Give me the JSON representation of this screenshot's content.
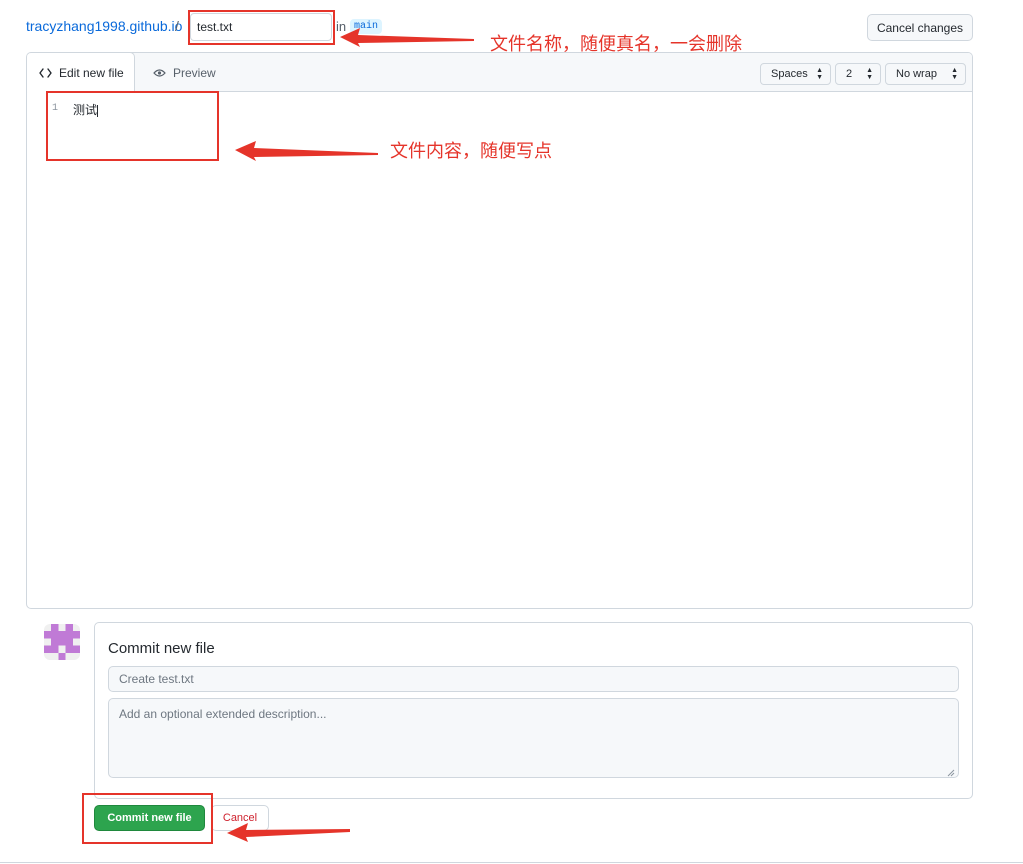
{
  "header": {
    "repo": "tracyzhang1998.github.io",
    "separator": "/",
    "filename_value": "test.txt",
    "in_label": "in",
    "branch": "main",
    "cancel_changes": "Cancel changes"
  },
  "editor": {
    "tabs": [
      {
        "label": "Edit new file",
        "icon": "code-icon",
        "active": true
      },
      {
        "label": "Preview",
        "icon": "eye-icon",
        "active": false
      }
    ],
    "indent_mode": "Spaces",
    "indent_size": "2",
    "wrap_mode": "No wrap",
    "lines": [
      {
        "number": "1",
        "text": "测试"
      }
    ]
  },
  "commit": {
    "title": "Commit new file",
    "summary_placeholder": "Create test.txt",
    "description_placeholder": "Add an optional extended description...",
    "commit_button": "Commit new file",
    "cancel_button": "Cancel"
  },
  "annotations": {
    "filename_note": "文件名称，随便真名，一会删除",
    "content_note": "文件内容，随便写点",
    "color": "#e5342a"
  },
  "colors": {
    "link": "#0969da",
    "primary_button": "#2da44e",
    "danger_text": "#cf222e",
    "border": "#d0d7de"
  }
}
